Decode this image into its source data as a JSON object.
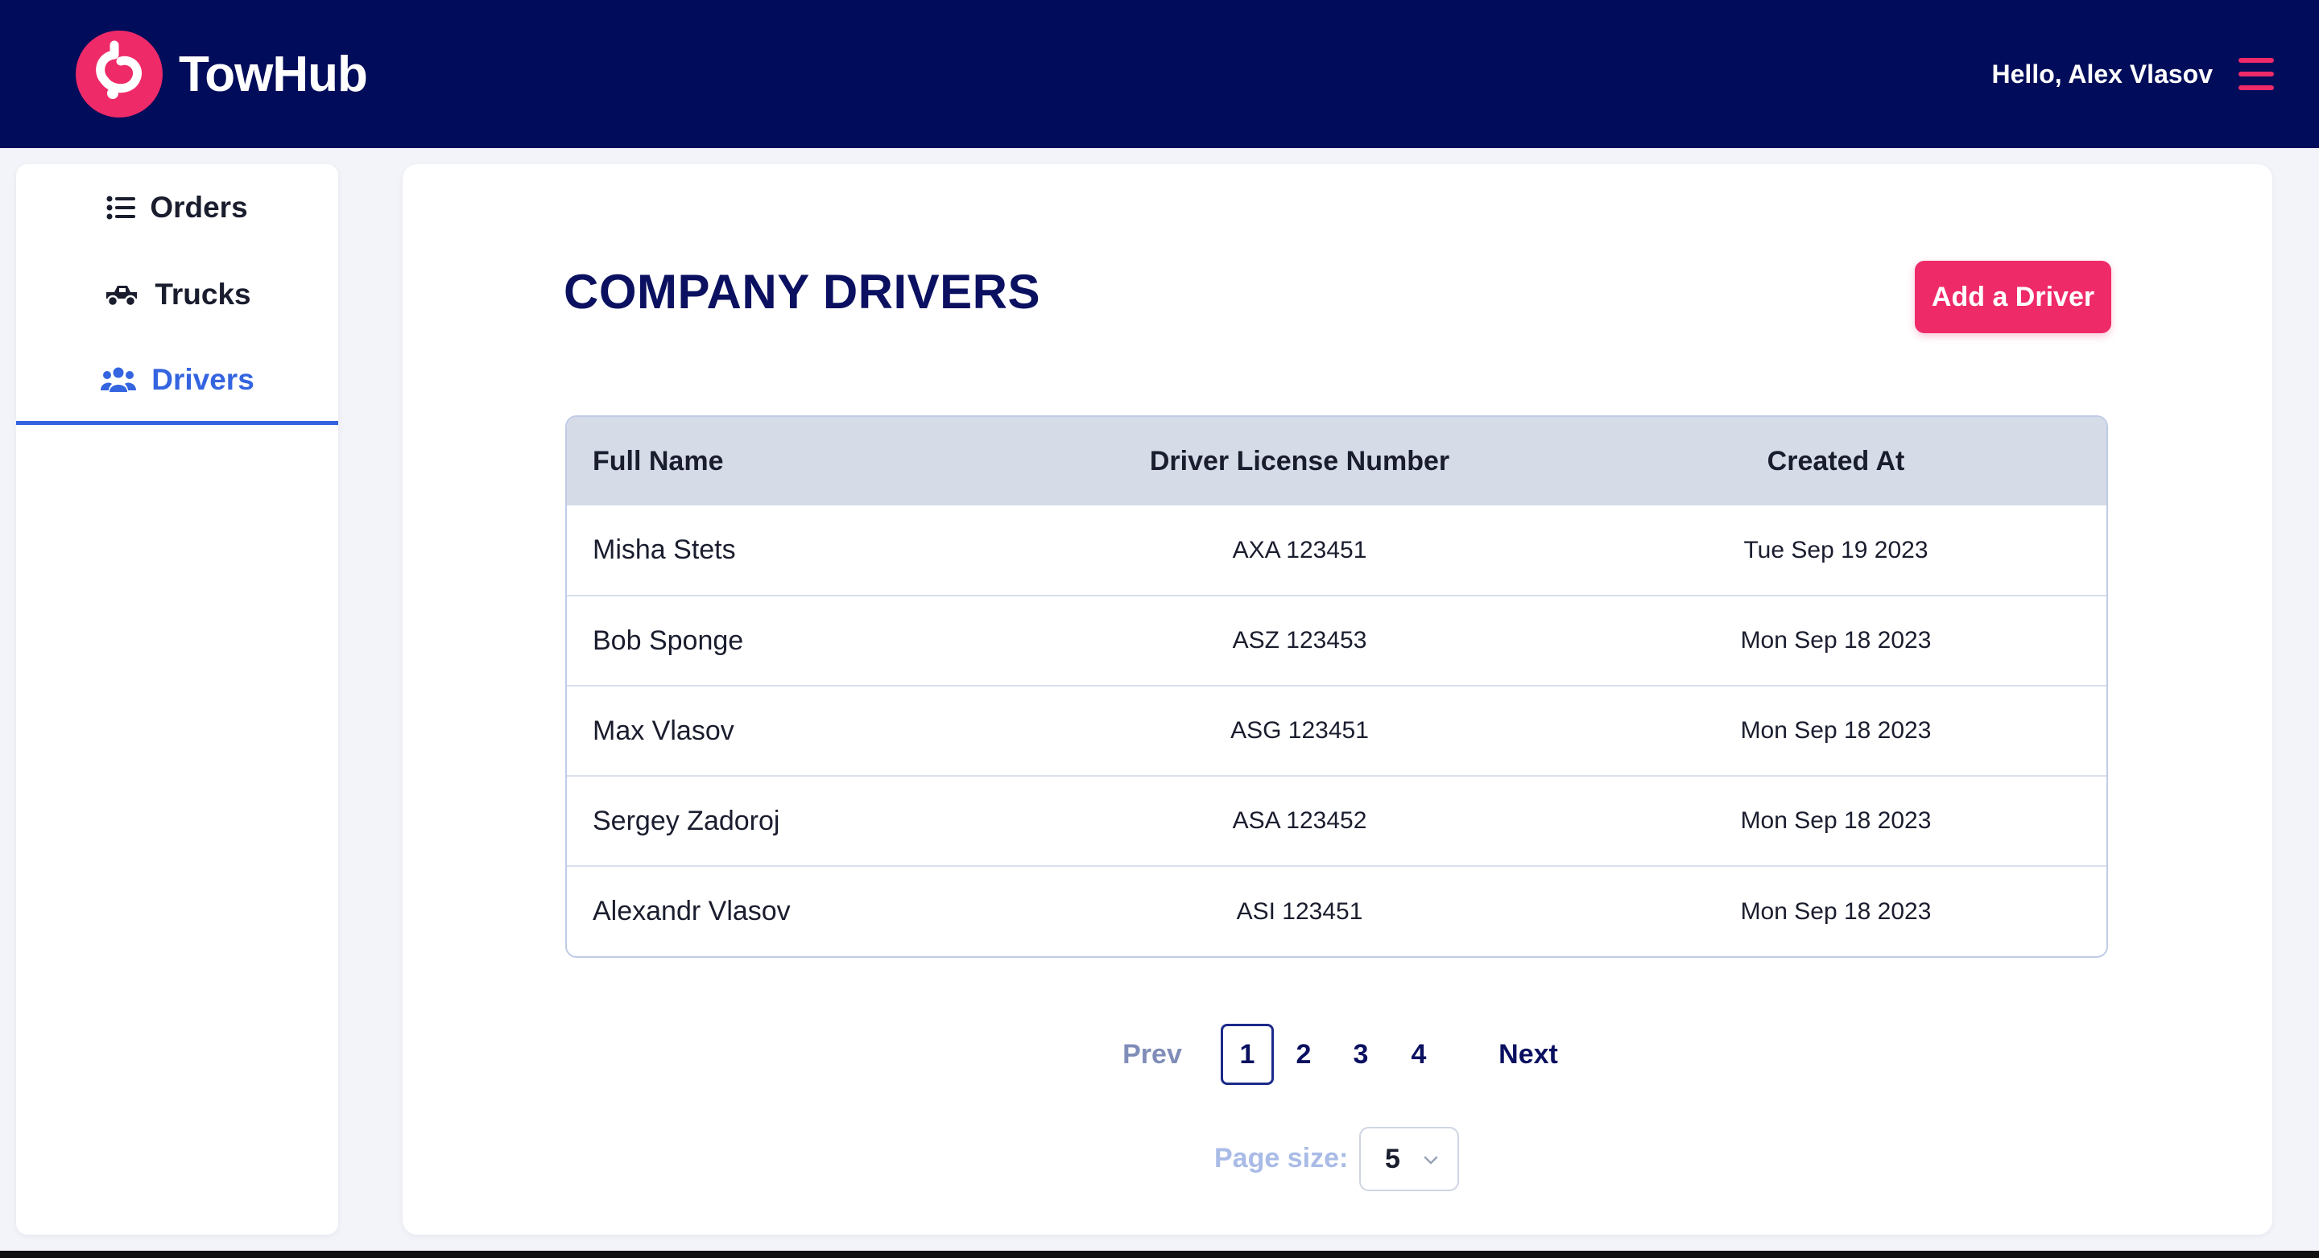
{
  "brand": {
    "name": "TowHub",
    "logo_icon": "tow-hook-icon",
    "accent": "#ee2a69",
    "header_bg": "#010c5a"
  },
  "header": {
    "greeting": "Hello, Alex Vlasov",
    "menu_icon": "hamburger-icon"
  },
  "sidebar": {
    "items": [
      {
        "label": "Orders",
        "icon": "list-icon",
        "active": false
      },
      {
        "label": "Trucks",
        "icon": "truck-icon",
        "active": false
      },
      {
        "label": "Drivers",
        "icon": "users-icon",
        "active": true
      }
    ],
    "active_color": "#3464e0"
  },
  "main": {
    "title": "COMPANY DRIVERS",
    "add_button": "Add a Driver",
    "table": {
      "columns": [
        "Full Name",
        "Driver License Number",
        "Created At"
      ],
      "rows": [
        {
          "name": "Misha Stets",
          "license": "AXA 123451",
          "created": "Tue Sep 19 2023"
        },
        {
          "name": "Bob Sponge",
          "license": "ASZ 123453",
          "created": "Mon Sep 18 2023"
        },
        {
          "name": "Max Vlasov",
          "license": "ASG 123451",
          "created": "Mon Sep 18 2023"
        },
        {
          "name": "Sergey Zadoroj",
          "license": "ASA 123452",
          "created": "Mon Sep 18 2023"
        },
        {
          "name": "Alexandr Vlasov",
          "license": "ASI 123451",
          "created": "Mon Sep 18 2023"
        }
      ]
    },
    "pagination": {
      "prev": "Prev",
      "pages": [
        "1",
        "2",
        "3",
        "4"
      ],
      "current": "1",
      "next": "Next",
      "page_size_label": "Page size:",
      "page_size_value": "5"
    }
  }
}
